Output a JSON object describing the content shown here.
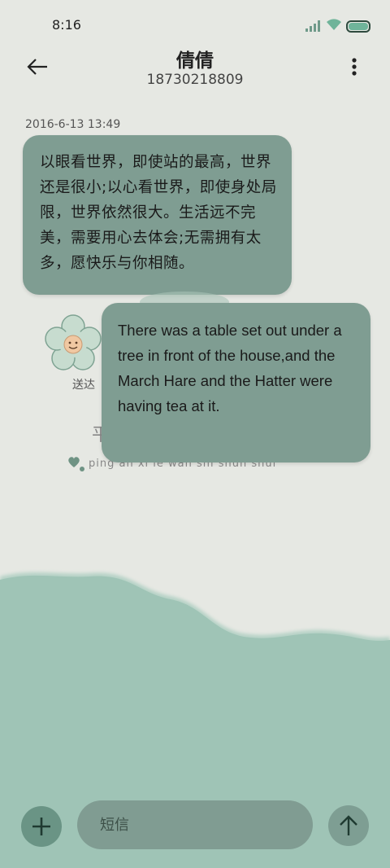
{
  "status_bar": {
    "time": "8:16",
    "icons": [
      "signal-icon",
      "wifi-icon",
      "battery-icon"
    ]
  },
  "header": {
    "contact_name": "倩倩",
    "contact_number": "18730218809",
    "icons": [
      "back-arrow-icon",
      "more-vertical-icon"
    ]
  },
  "conversation": {
    "timestamp": "2016-6-13 13:49",
    "messages": [
      {
        "text": "以眼看世界，即使站的最高，世界还是很小;以心看世界，即使身处局限，世界依然很大。生活远不完美，需要用心去体会;无需拥有太多，愿快乐与你相随。"
      },
      {
        "text": "There was a table set out under a tree in front of the house,and the March Hare and the Hatter were having tea at it."
      }
    ],
    "sent_status": "送达",
    "decor_char": "平",
    "decor_pinyin": "ping an xi le wan shi shun shui"
  },
  "input_bar": {
    "placeholder": "短信",
    "icons": [
      "plus-icon",
      "send-arrow-icon"
    ]
  },
  "colors": {
    "background": "#e6e8e3",
    "bubble": "#7f9d92",
    "wave": "#9fc4b6",
    "button": "#6a9485"
  }
}
